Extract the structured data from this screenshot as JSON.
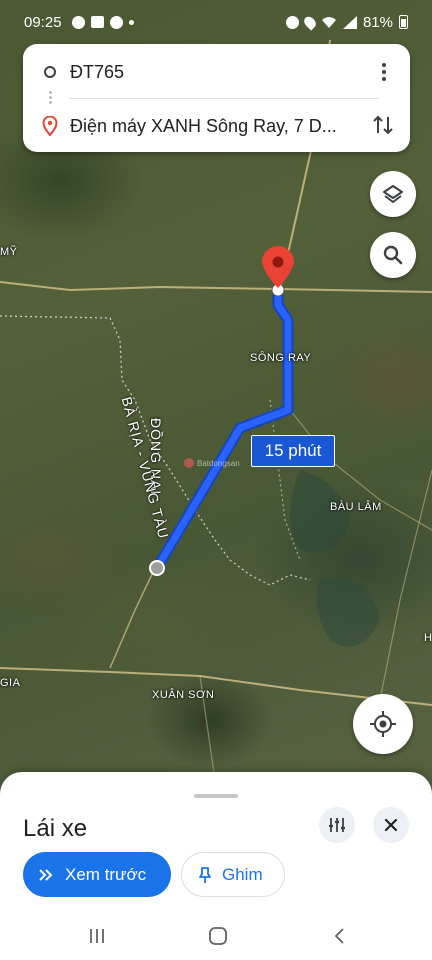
{
  "status_bar": {
    "time": "09:25",
    "battery": "81%"
  },
  "route": {
    "origin": "ĐT765",
    "destination": "Điện máy XANH Sông Ray, 7 D..."
  },
  "map": {
    "labels": {
      "song_ray": "SÔNG RAY",
      "bau_lam": "BÀU LÂM",
      "xuan_son": "XUÂN SƠN",
      "my": "MỸ",
      "gia": "GIA",
      "h": "H"
    },
    "province_labels": {
      "dong_nai": "ĐỒNG NAI",
      "ba_ria_vung_tau": "BÀ RỊA - VŨNG TÀU"
    },
    "watermark": "Batdongsan",
    "eta": "15 phút",
    "route_color": "#2962ff"
  },
  "sheet": {
    "mode_title": "Lái xe",
    "preview_label": "Xem trước",
    "pin_label": "Ghim"
  },
  "colors": {
    "accent": "#1a73e8",
    "pin": "#ea4335"
  }
}
